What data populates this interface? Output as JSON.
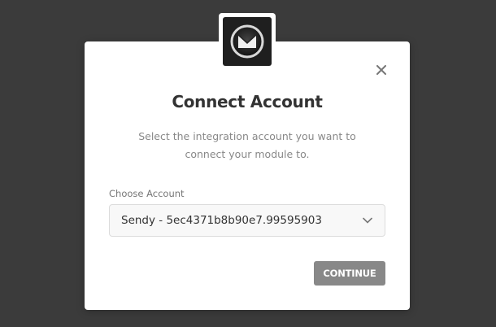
{
  "modal": {
    "title": "Connect Account",
    "description": "Select the integration account you want to connect your module to.",
    "field_label": "Choose Account",
    "selected_account": "Sendy - 5ec4371b8b90e7.99595903",
    "continue_label": "CONTINUE"
  },
  "logo": {
    "icon": "sendy-envelope-icon"
  },
  "colors": {
    "overlay": "#3b3b3b",
    "modal_bg": "#ffffff",
    "button_bg": "#888888",
    "logo_bg": "#1f1f1f"
  }
}
